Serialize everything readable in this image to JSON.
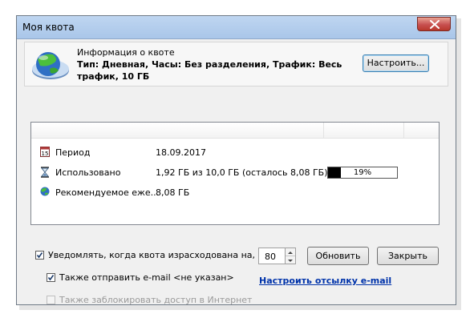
{
  "window": {
    "title": "Моя квота"
  },
  "info": {
    "group_title": "Информация о квоте",
    "line1": "Тип: Дневная, Часы: Без разделения, Трафик: Весь",
    "line2": "трафик, 10 ГБ",
    "configure_button": "Настроить..."
  },
  "stats": {
    "rows": [
      {
        "icon": "calendar-icon",
        "name": "Период",
        "value": "18.09.2017"
      },
      {
        "icon": "hourglass-icon",
        "name": "Использовано",
        "value": "1,92 ГБ из 10,0 ГБ (осталось 8,08 ГБ)",
        "progress_label": "19%",
        "progress_percent": 19
      },
      {
        "icon": "globe-icon",
        "name": "Рекомендуемое еже...",
        "value": "8,08 ГБ"
      }
    ]
  },
  "options": {
    "notify_label": "Уведомлять, когда квота израсходована на, %",
    "notify_checked": true,
    "notify_percent": "80",
    "email_label": "Также отправить e-mail <не указан>",
    "email_checked": true,
    "email_link": "Настроить отсылку e-mail",
    "block_label": "Также заблокировать доступ в Интернет",
    "block_checked": false,
    "block_disabled": true
  },
  "buttons": {
    "refresh": "Обновить",
    "close": "Закрыть"
  },
  "colors": {
    "titlebar": "#bfd6f1",
    "close_button": "#c75050",
    "link": "#0033aa",
    "progress_fill": "#000000"
  }
}
